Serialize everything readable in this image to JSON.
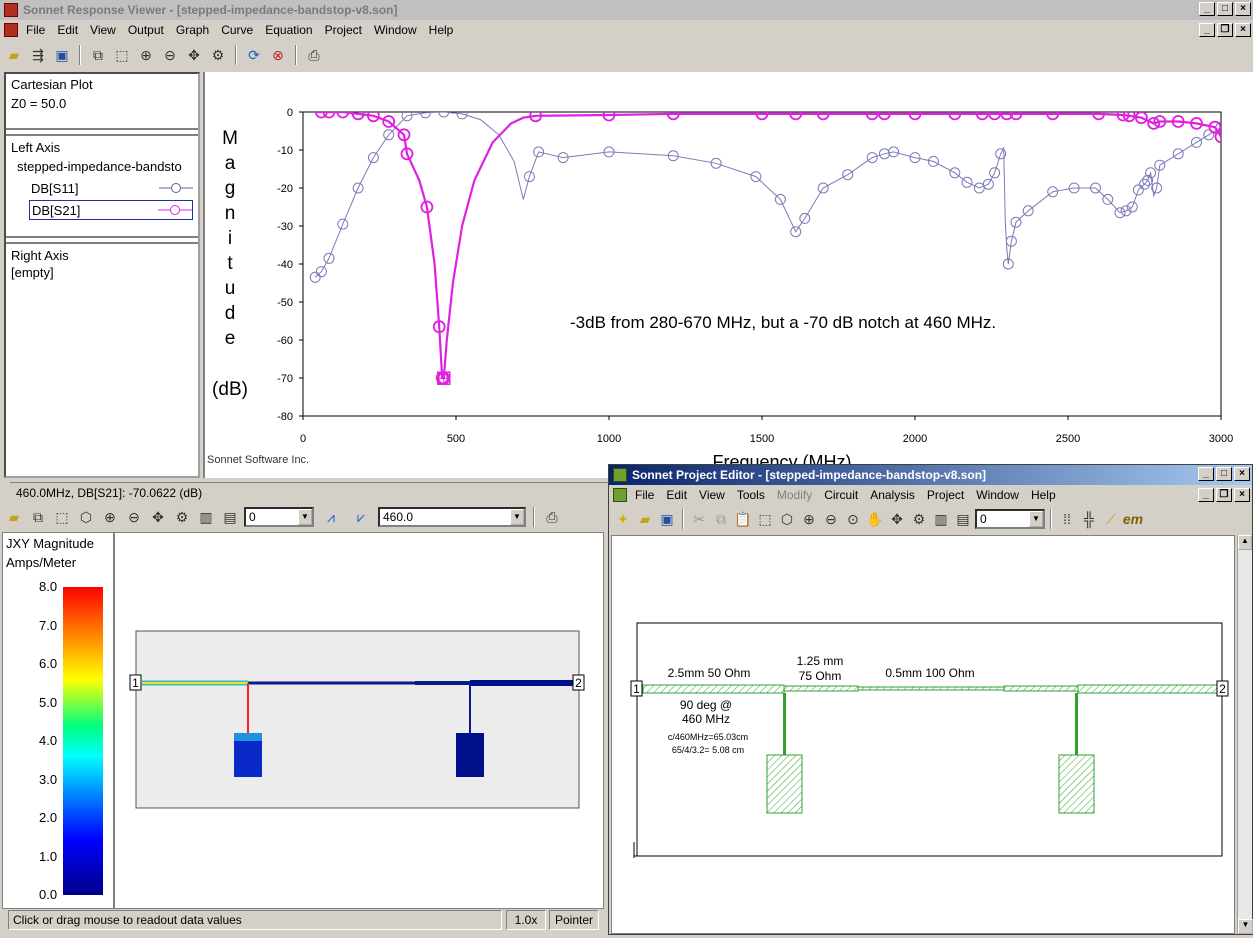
{
  "response_viewer": {
    "title": "Sonnet Response Viewer - [stepped-impedance-bandstop-v8.son]",
    "menu": [
      "File",
      "Edit",
      "View",
      "Output",
      "Graph",
      "Curve",
      "Equation",
      "Project",
      "Window",
      "Help"
    ],
    "left_panel": {
      "plot_type": "Cartesian Plot",
      "z0": "Z0 = 50.0",
      "left_axis_header": "Left Axis",
      "project_name": "stepped-impedance-bandsto",
      "curves": [
        "DB[S11]",
        "DB[S21]"
      ],
      "right_axis_header": "Right Axis",
      "right_axis_value": "[empty]"
    },
    "y_axis_letters": [
      "M",
      "a",
      "g",
      "n",
      "i",
      "t",
      "u",
      "d",
      "e"
    ],
    "y_axis_unit": "(dB)",
    "x_axis_label": "Frequency (MHz)",
    "annotation": "-3dB from 280-670 MHz, but a -70 dB notch at 460 MHz.",
    "footer": "Sonnet Software Inc.",
    "readout": "460.0MHz, DB[S21]: -70.0622  (dB)"
  },
  "chart_data": {
    "type": "line",
    "xlabel": "Frequency (MHz)",
    "ylabel": "Magnitude (dB)",
    "xlim": [
      0,
      3000
    ],
    "ylim": [
      -80,
      0
    ],
    "x_ticks": [
      "0",
      "500",
      "1000",
      "1500",
      "2000",
      "2500",
      "3000"
    ],
    "y_ticks": [
      "0",
      "-10",
      "-20",
      "-30",
      "-40",
      "-50",
      "-60",
      "-70",
      "-80"
    ],
    "series": [
      {
        "name": "DB[S11]",
        "color": "#7a7ab8",
        "points": [
          [
            40,
            -43.5
          ],
          [
            60,
            -42
          ],
          [
            85,
            -38.5
          ],
          [
            130,
            -29.5
          ],
          [
            180,
            -20
          ],
          [
            230,
            -12
          ],
          [
            280,
            -6
          ],
          [
            340,
            -1
          ],
          [
            400,
            -0.2
          ],
          [
            460,
            0
          ],
          [
            520,
            -0.5
          ],
          [
            580,
            -2
          ],
          [
            640,
            -6
          ],
          [
            690,
            -13
          ],
          [
            720,
            -23
          ],
          [
            740,
            -17
          ],
          [
            770,
            -10.5
          ],
          [
            850,
            -12
          ],
          [
            1000,
            -10.5
          ],
          [
            1210,
            -11.5
          ],
          [
            1350,
            -13.5
          ],
          [
            1480,
            -17
          ],
          [
            1560,
            -23
          ],
          [
            1610,
            -31.5
          ],
          [
            1640,
            -28
          ],
          [
            1700,
            -20
          ],
          [
            1780,
            -16.5
          ],
          [
            1860,
            -12
          ],
          [
            1900,
            -11
          ],
          [
            1930,
            -10.5
          ],
          [
            2000,
            -12
          ],
          [
            2060,
            -13
          ],
          [
            2130,
            -16
          ],
          [
            2170,
            -18.5
          ],
          [
            2210,
            -20
          ],
          [
            2240,
            -19
          ],
          [
            2260,
            -16
          ],
          [
            2280,
            -11
          ],
          [
            2290,
            -9.5
          ],
          [
            2295,
            -29
          ],
          [
            2300,
            -36
          ],
          [
            2305,
            -40
          ],
          [
            2315,
            -34
          ],
          [
            2330,
            -29
          ],
          [
            2370,
            -26
          ],
          [
            2450,
            -21
          ],
          [
            2520,
            -20
          ],
          [
            2590,
            -20
          ],
          [
            2630,
            -23
          ],
          [
            2670,
            -26.5
          ],
          [
            2690,
            -26
          ],
          [
            2710,
            -25
          ],
          [
            2730,
            -20.5
          ],
          [
            2750,
            -19
          ],
          [
            2760,
            -18
          ],
          [
            2770,
            -16
          ],
          [
            2780,
            -22
          ],
          [
            2790,
            -20
          ],
          [
            2800,
            -14
          ],
          [
            2860,
            -11
          ],
          [
            2920,
            -8
          ],
          [
            2960,
            -6
          ],
          [
            3000,
            -4
          ]
        ]
      },
      {
        "name": "DB[S21]",
        "color": "#e020e0",
        "points": [
          [
            40,
            0
          ],
          [
            60,
            0
          ],
          [
            85,
            0
          ],
          [
            130,
            0
          ],
          [
            180,
            -0.5
          ],
          [
            230,
            -1
          ],
          [
            280,
            -2.5
          ],
          [
            330,
            -6
          ],
          [
            340,
            -11
          ],
          [
            380,
            -18
          ],
          [
            405,
            -25
          ],
          [
            430,
            -40
          ],
          [
            445,
            -56.5
          ],
          [
            455,
            -70
          ],
          [
            460,
            -70.06
          ],
          [
            470,
            -60
          ],
          [
            490,
            -45
          ],
          [
            520,
            -30
          ],
          [
            560,
            -18
          ],
          [
            620,
            -8
          ],
          [
            680,
            -3
          ],
          [
            720,
            -1.5
          ],
          [
            760,
            -1
          ],
          [
            1000,
            -0.8
          ],
          [
            1210,
            -0.5
          ],
          [
            1500,
            -0.5
          ],
          [
            1610,
            -0.5
          ],
          [
            1700,
            -0.5
          ],
          [
            1860,
            -0.5
          ],
          [
            1900,
            -0.5
          ],
          [
            2000,
            -0.5
          ],
          [
            2130,
            -0.5
          ],
          [
            2220,
            -0.5
          ],
          [
            2260,
            -0.5
          ],
          [
            2300,
            -0.5
          ],
          [
            2330,
            -0.5
          ],
          [
            2450,
            -0.5
          ],
          [
            2600,
            -0.5
          ],
          [
            2680,
            -0.8
          ],
          [
            2700,
            -1
          ],
          [
            2740,
            -1.5
          ],
          [
            2780,
            -3
          ],
          [
            2800,
            -2.5
          ],
          [
            2860,
            -2.5
          ],
          [
            2920,
            -3
          ],
          [
            2980,
            -4
          ],
          [
            3000,
            -6.5
          ]
        ]
      }
    ]
  },
  "current_view": {
    "toolbar_level": "0",
    "frequency": "460.0",
    "legend_title": "JXY Magnitude",
    "legend_unit": "Amps/Meter",
    "legend_values": [
      "8.0",
      "7.0",
      "6.0",
      "5.0",
      "4.0",
      "3.0",
      "2.0",
      "1.0",
      "0.0"
    ],
    "port1": "1",
    "port2": "2",
    "status": "Click or drag mouse to readout data values",
    "zoom": "1.0x",
    "mode": "Pointer"
  },
  "project_editor": {
    "title": "Sonnet Project Editor - [stepped-impedance-bandstop-v8.son]",
    "menu": [
      "File",
      "Edit",
      "View",
      "Tools",
      "Modify",
      "Circuit",
      "Analysis",
      "Project",
      "Window",
      "Help"
    ],
    "toolbar_level": "0",
    "labels": {
      "seg1": "2.5mm 50 Ohm",
      "seg2_a": "1.25 mm",
      "seg2_b": "75 Ohm",
      "seg3": "0.5mm 100 Ohm",
      "stub_a": "90 deg @",
      "stub_b": "460 MHz",
      "calc1": "c/460MHz=65.03cm",
      "calc2": "65/4/3.2= 5.08 cm"
    },
    "port1": "1",
    "port2": "2"
  }
}
